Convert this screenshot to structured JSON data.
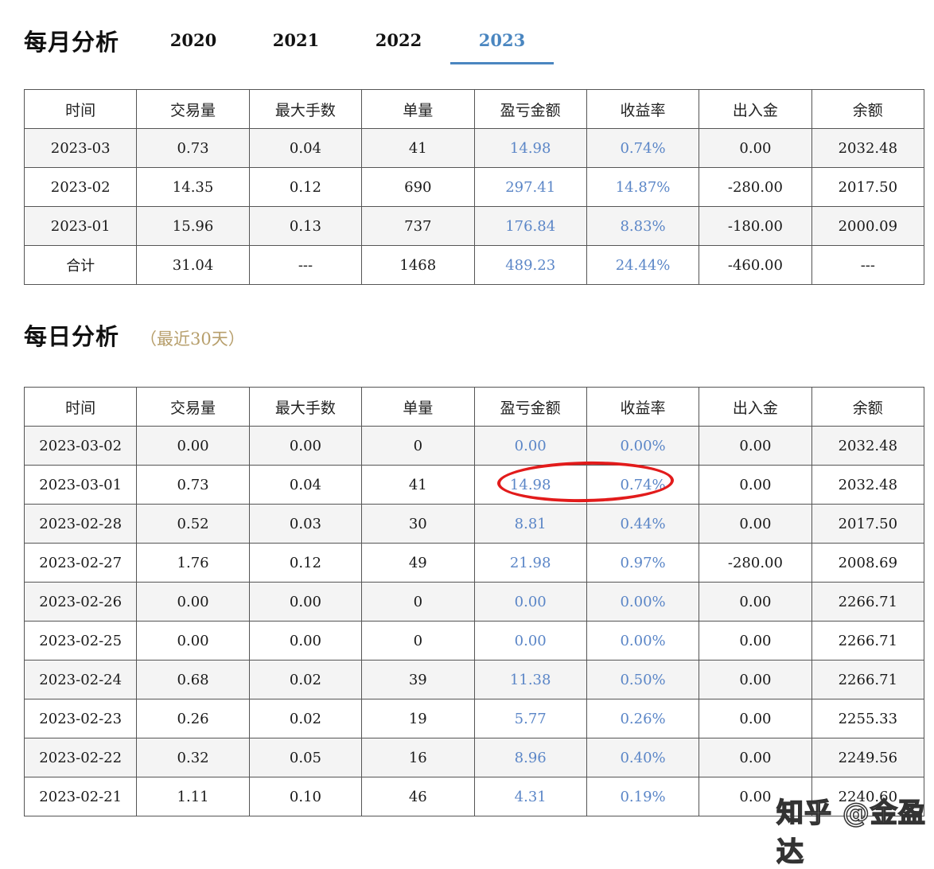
{
  "monthly": {
    "title": "每月分析",
    "years": [
      "2020",
      "2021",
      "2022",
      "2023"
    ],
    "active_year": "2023",
    "columns": [
      "时间",
      "交易量",
      "最大手数",
      "单量",
      "盈亏金额",
      "收益率",
      "出入金",
      "余额"
    ],
    "rows": [
      [
        "2023-03",
        "0.73",
        "0.04",
        "41",
        "14.98",
        "0.74%",
        "0.00",
        "2032.48"
      ],
      [
        "2023-02",
        "14.35",
        "0.12",
        "690",
        "297.41",
        "14.87%",
        "-280.00",
        "2017.50"
      ],
      [
        "2023-01",
        "15.96",
        "0.13",
        "737",
        "176.84",
        "8.83%",
        "-180.00",
        "2000.09"
      ],
      [
        "合计",
        "31.04",
        "---",
        "1468",
        "489.23",
        "24.44%",
        "-460.00",
        "---"
      ]
    ]
  },
  "daily": {
    "title": "每日分析",
    "subtitle": "（最近30天）",
    "columns": [
      "时间",
      "交易量",
      "最大手数",
      "单量",
      "盈亏金额",
      "收益率",
      "出入金",
      "余额"
    ],
    "rows": [
      [
        "2023-03-02",
        "0.00",
        "0.00",
        "0",
        "0.00",
        "0.00%",
        "0.00",
        "2032.48"
      ],
      [
        "2023-03-01",
        "0.73",
        "0.04",
        "41",
        "14.98",
        "0.74%",
        "0.00",
        "2032.48"
      ],
      [
        "2023-02-28",
        "0.52",
        "0.03",
        "30",
        "8.81",
        "0.44%",
        "0.00",
        "2017.50"
      ],
      [
        "2023-02-27",
        "1.76",
        "0.12",
        "49",
        "21.98",
        "0.97%",
        "-280.00",
        "2008.69"
      ],
      [
        "2023-02-26",
        "0.00",
        "0.00",
        "0",
        "0.00",
        "0.00%",
        "0.00",
        "2266.71"
      ],
      [
        "2023-02-25",
        "0.00",
        "0.00",
        "0",
        "0.00",
        "0.00%",
        "0.00",
        "2266.71"
      ],
      [
        "2023-02-24",
        "0.68",
        "0.02",
        "39",
        "11.38",
        "0.50%",
        "0.00",
        "2266.71"
      ],
      [
        "2023-02-23",
        "0.26",
        "0.02",
        "19",
        "5.77",
        "0.26%",
        "0.00",
        "2255.33"
      ],
      [
        "2023-02-22",
        "0.32",
        "0.05",
        "16",
        "8.96",
        "0.40%",
        "0.00",
        "2249.56"
      ],
      [
        "2023-02-21",
        "1.11",
        "0.10",
        "46",
        "4.31",
        "0.19%",
        "0.00",
        "2240.60"
      ]
    ]
  },
  "watermark": "知乎 @金盈达",
  "colors": {
    "accent": "#4a86c0",
    "value_blue": "#5b86c7",
    "subtitle_gold": "#b79f6c",
    "annotation_red": "#e21b1b"
  }
}
